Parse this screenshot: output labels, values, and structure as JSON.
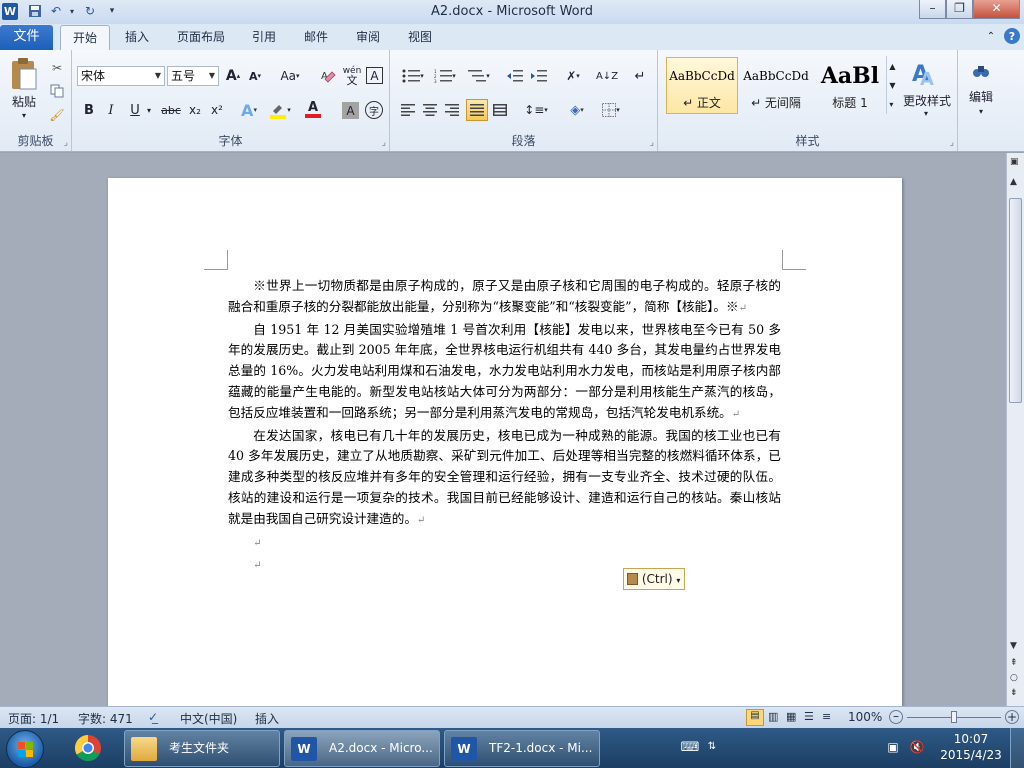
{
  "app": {
    "window_title": "A2.docx - Microsoft Word",
    "icon_letter": "W",
    "help_label": "?"
  },
  "tabs": [
    "文件",
    "开始",
    "插入",
    "页面布局",
    "引用",
    "邮件",
    "审阅",
    "视图"
  ],
  "ribbon": {
    "clipboard": {
      "label": "剪贴板",
      "paste": "粘贴"
    },
    "font": {
      "label": "字体",
      "font_name": "宋体",
      "font_size": "五号",
      "bold": "B",
      "italic": "I",
      "underline": "U",
      "strike": "abc",
      "subscript": "x₂",
      "superscript": "x²",
      "grow": "A",
      "shrink": "A",
      "change_case": "Aa",
      "wen": "wén",
      "char_border": "A",
      "text_effects": "A",
      "font_color": "A",
      "char_shading": "A",
      "enclose": "字"
    },
    "paragraph": {
      "label": "段落"
    },
    "styles": {
      "label": "样式",
      "items": [
        {
          "sample": "AaBbCcDd",
          "name": "↵ 正文"
        },
        {
          "sample": "AaBbCcDd",
          "name": "↵ 无间隔"
        },
        {
          "sample": "AaBl",
          "name": "标题 1"
        }
      ],
      "change": "更改样式"
    },
    "editing": {
      "label": "编辑"
    }
  },
  "document": {
    "paragraphs": [
      "※世界上一切物质都是由原子构成的，原子又是由原子核和它周围的电子构成的。轻原子核的融合和重原子核的分裂都能放出能量，分别称为“核聚变能”和“核裂变能”，简称【核能】。※",
      "自 1951 年 12 月美国实验增殖堆 1 号首次利用【核能】发电以来，世界核电至今已有 50 多年的发展历史。截止到 2005 年年底，全世界核电运行机组共有 440 多台，其发电量约占世界发电总量的 16%。火力发电站利用煤和石油发电，水力发电站利用水力发电，而核站是利用原子核内部蕴藏的能量产生电能的。新型发电站核站大体可分为两部分：一部分是利用核能生产蒸汽的核岛，包括反应堆装置和一回路系统；另一部分是利用蒸汽发电的常规岛，包括汽轮发电机系统。",
      "在发达国家，核电已有几十年的发展历史，核电已成为一种成熟的能源。我国的核工业也已有 40 多年发展历史，建立了从地质勘察、采矿到元件加工、后处理等相当完整的核燃料循环体系，已建成多种类型的核反应堆并有多年的安全管理和运行经验，拥有一支专业齐全、技术过硬的队伍。核站的建设和运行是一项复杂的技术。我国目前已经能够设计、建造和运行自己的核站。秦山核站就是由我国自己研究设计建造的。"
    ],
    "paragraph_mark": "↵",
    "paste_options": "(Ctrl)"
  },
  "status": {
    "page": "页面: 1/1",
    "words": "字数: 471",
    "language": "中文(中国)",
    "mode": "插入",
    "zoom": "100%"
  },
  "taskbar": {
    "items": [
      "考生文件夹",
      "A2.docx - Micro...",
      "TF2-1.docx - Mi..."
    ],
    "time": "10:07",
    "date": "2015/4/23"
  }
}
